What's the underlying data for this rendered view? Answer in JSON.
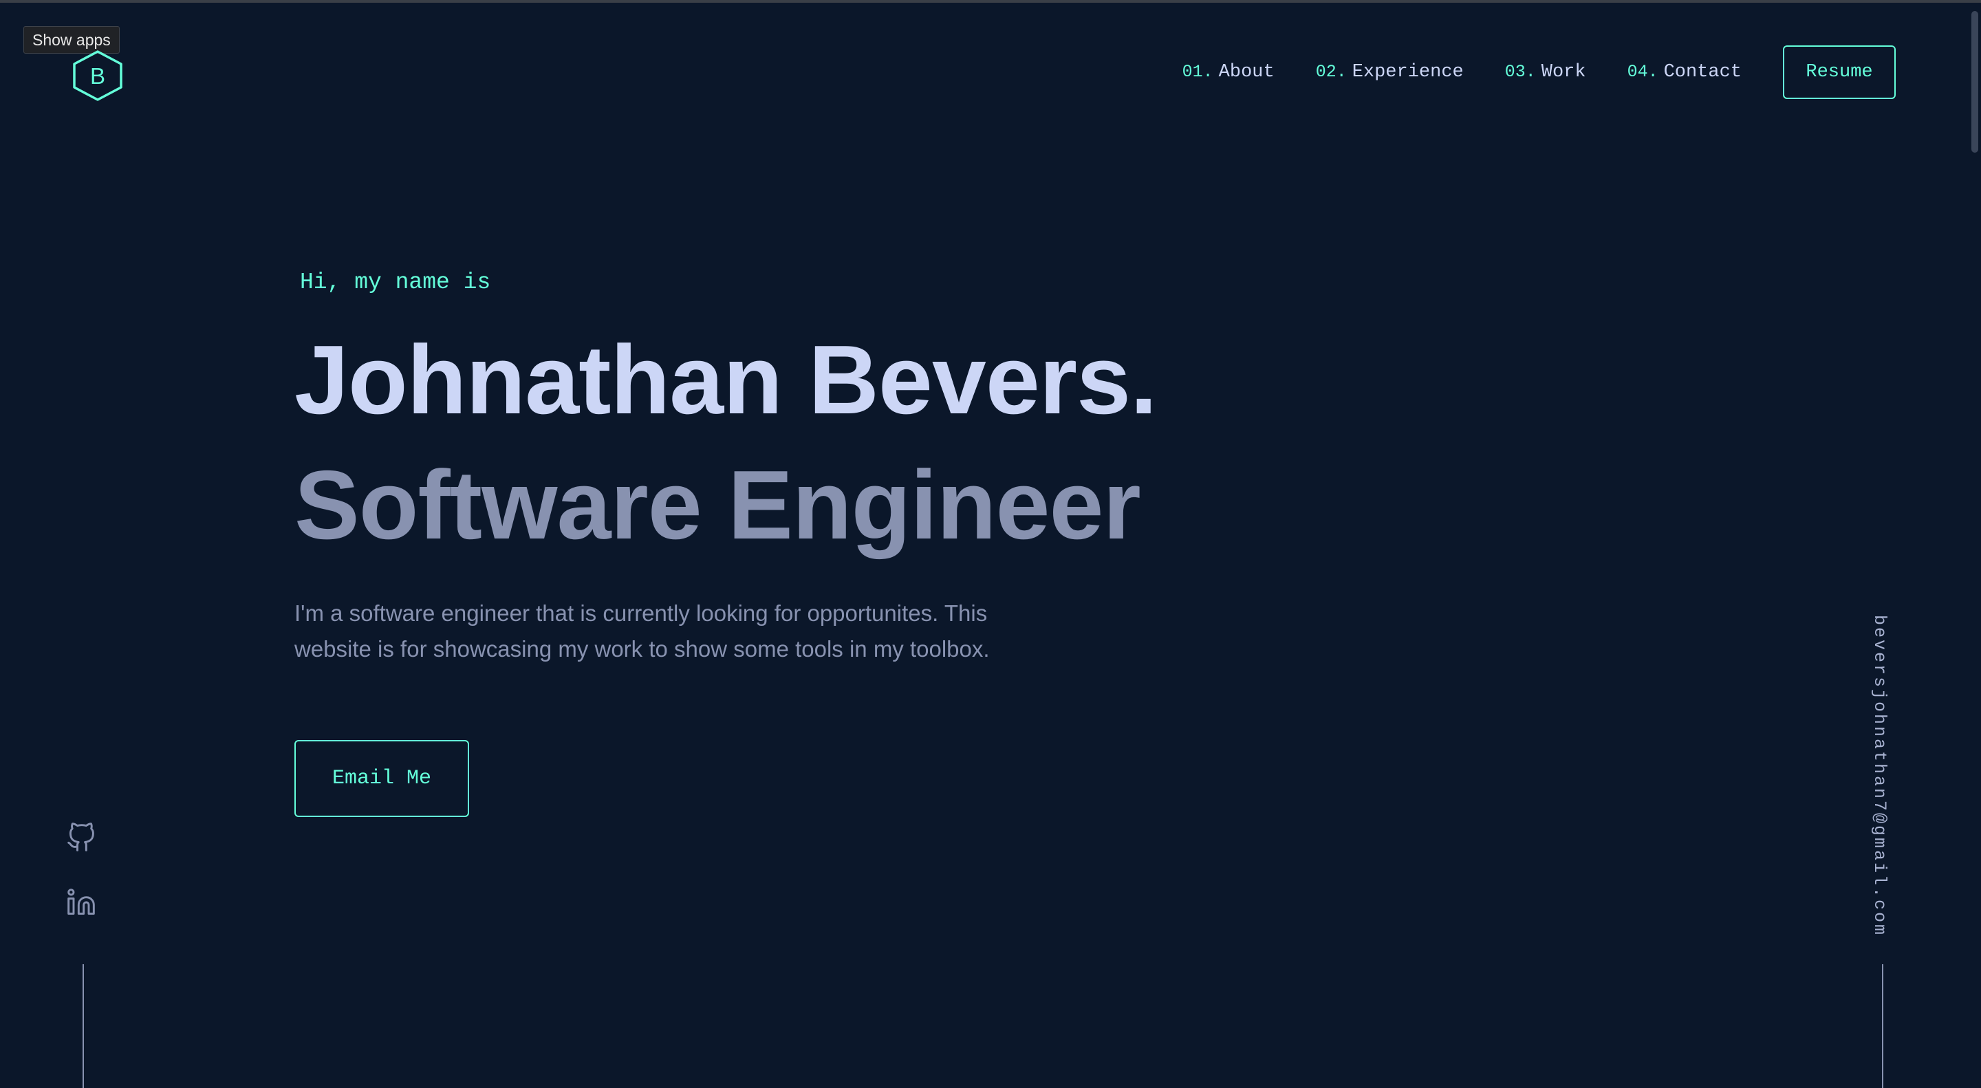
{
  "browser": {
    "tooltip": "Show apps"
  },
  "logo": {
    "letter": "B",
    "icon": "hexagon-logo-icon"
  },
  "nav": {
    "items": [
      {
        "number": "01.",
        "label": "About"
      },
      {
        "number": "02.",
        "label": "Experience"
      },
      {
        "number": "03.",
        "label": "Work"
      },
      {
        "number": "04.",
        "label": "Contact"
      }
    ],
    "resume_label": "Resume"
  },
  "hero": {
    "greeting": "Hi, my name is",
    "name": "Johnathan Bevers.",
    "title": "Software Engineer",
    "description": "I'm a software engineer that is currently looking for opportunites. This website is for showcasing my work to show some tools in my toolbox.",
    "cta_label": "Email Me"
  },
  "social": {
    "icons": [
      "github-icon",
      "linkedin-icon"
    ]
  },
  "side_email": "beversjohnathan7@gmail.com",
  "colors": {
    "background": "#0b172a",
    "accent": "#64ffda",
    "heading": "#ccd6f6",
    "text": "#8892b0"
  }
}
